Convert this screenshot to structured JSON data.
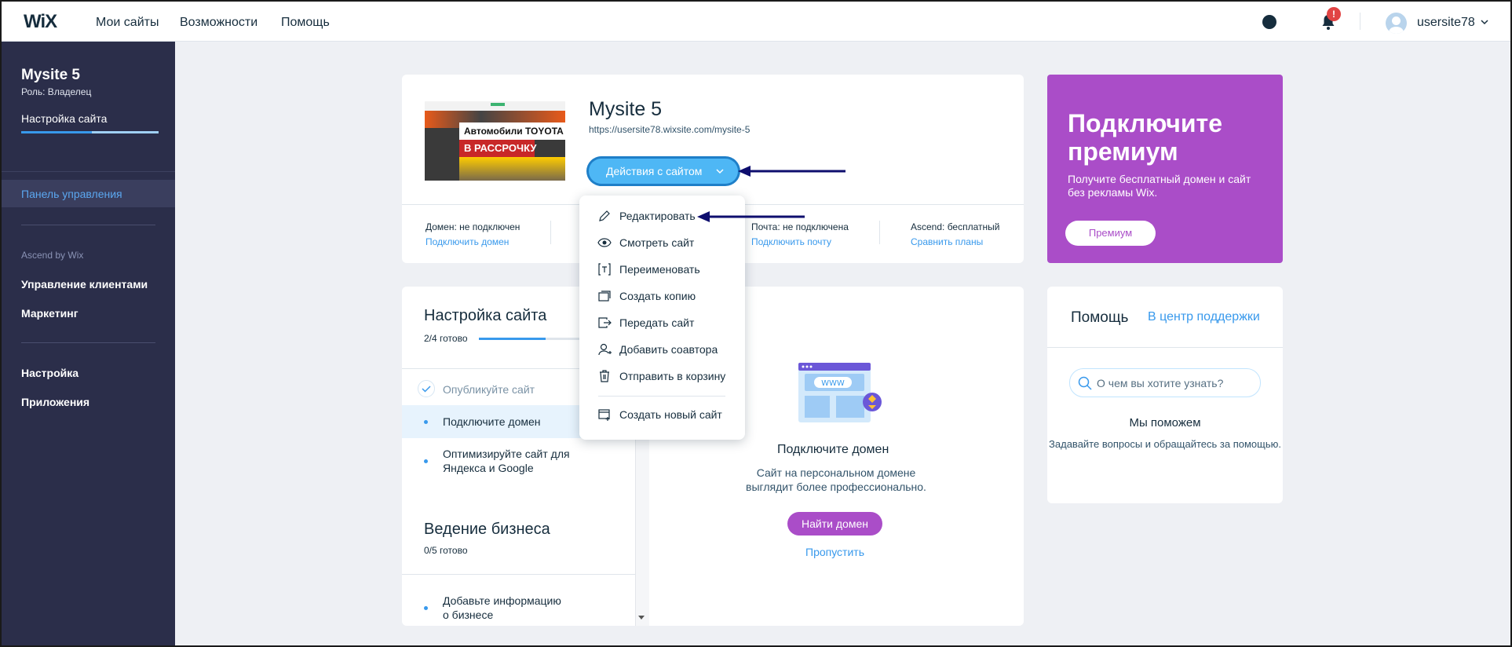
{
  "topbar": {
    "logo": "WiX",
    "nav": [
      "Мои сайты",
      "Возможности",
      "Помощь"
    ],
    "notifications_badge": "!",
    "username": "usersite78"
  },
  "sidebar": {
    "site_name": "Mysite 5",
    "role": "Роль: Владелец",
    "setup_label": "Настройка сайта",
    "setup_progress": 0.5,
    "active_item": "Панель управления",
    "section_label": "Ascend by Wix",
    "items_ascend": [
      "Управление клиентами",
      "Маркетинг"
    ],
    "items_bottom": [
      "Настройка",
      "Приложения"
    ]
  },
  "site_card": {
    "thumb_text_1": "Автомобили TOYOTA",
    "thumb_text_2": "В РАССРОЧКУ",
    "title": "Mysite 5",
    "url": "https://usersite78.wixsite.com/mysite-5",
    "actions_button": "Действия с сайтом",
    "domain_label": "Домен: не подключен",
    "domain_link": "Подключить домен",
    "mail_label": "Почта: не подключена",
    "mail_link": "Подключить почту",
    "ascend_label": "Ascend: бесплатный",
    "ascend_link": "Сравнить планы"
  },
  "actions_menu": {
    "items": [
      {
        "label": "Редактировать",
        "icon": "pencil-icon"
      },
      {
        "label": "Смотреть сайт",
        "icon": "eye-icon"
      },
      {
        "label": "Переименовать",
        "icon": "rename-icon"
      },
      {
        "label": "Создать копию",
        "icon": "copy-icon"
      },
      {
        "label": "Передать сайт",
        "icon": "transfer-icon"
      },
      {
        "label": "Добавить соавтора",
        "icon": "add-user-icon"
      },
      {
        "label": "Отправить в корзину",
        "icon": "trash-icon"
      }
    ],
    "create_new": "Создать новый сайт"
  },
  "premium": {
    "title": "Подключите премиум",
    "subtitle": "Получите бесплатный домен и сайт без рекламы Wix.",
    "button": "Премиум",
    "color": "#aa4dc8"
  },
  "setup": {
    "title": "Настройка сайта",
    "count": "2/4 готово",
    "progress": 0.5,
    "tasks": [
      {
        "label": "Опубликуйте сайт",
        "done": true
      },
      {
        "label": "Подключите домен",
        "selected": true
      },
      {
        "label": "Оптимизируйте сайт для Яндекса и Google"
      }
    ],
    "business_title": "Ведение бизнеса",
    "business_count": "0/5 готово",
    "business_tasks": [
      "Добавьте информацию о бизнесе"
    ]
  },
  "domain_panel": {
    "illustration_text": "WWW",
    "title": "Подключите домен",
    "subtitle": "Сайт на персональном домене выглядит более профессионально.",
    "button": "Найти домен",
    "skip": "Пропустить"
  },
  "help": {
    "title": "Помощь",
    "link": "В центр поддержки",
    "search_placeholder": "О чем вы хотите узнать?",
    "heading": "Мы поможем",
    "description": "Задавайте вопросы и обращайтесь за помощью."
  },
  "colors": {
    "accent": "#3899ec",
    "sidebar": "#2b2e4a",
    "premium": "#aa4dc8",
    "action_button": "#4eb7f5"
  }
}
